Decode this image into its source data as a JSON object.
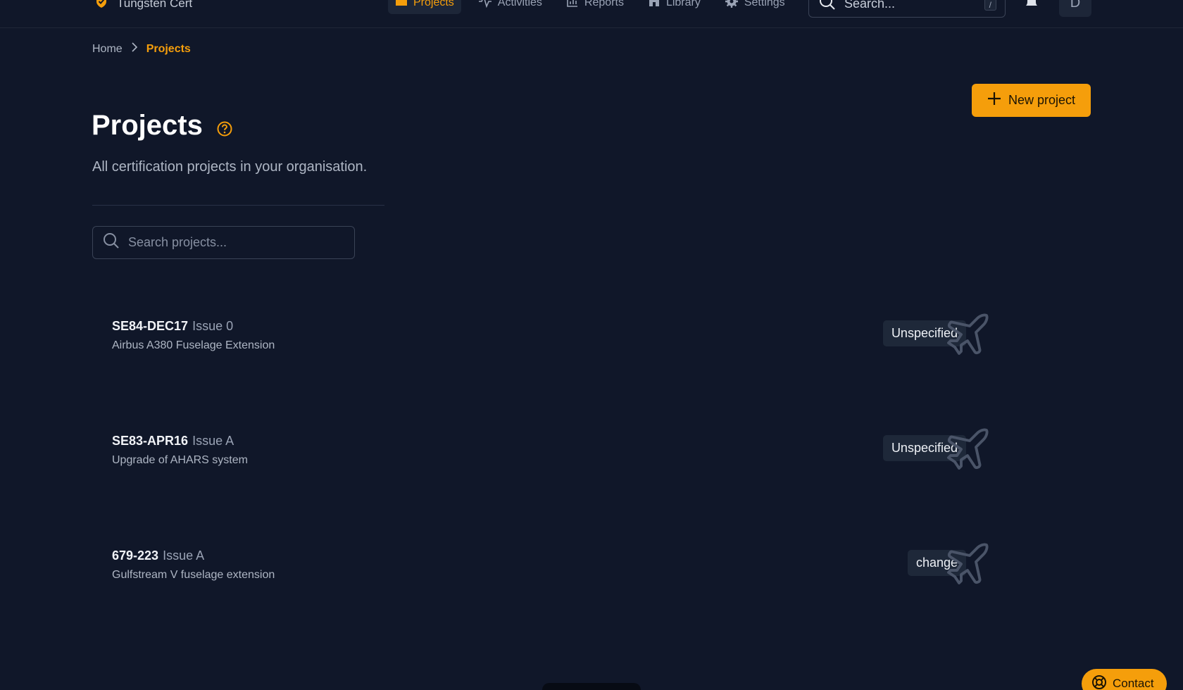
{
  "app": {
    "name": "Tungsten Cert",
    "accent": "#f59e0b",
    "background": "#101729"
  },
  "nav": [
    {
      "label": "Projects",
      "icon": "folder-icon",
      "active": true
    },
    {
      "label": "Activities",
      "icon": "activity-icon",
      "active": false
    },
    {
      "label": "Reports",
      "icon": "bar-chart-icon",
      "active": false
    },
    {
      "label": "Library",
      "icon": "library-icon",
      "active": false
    },
    {
      "label": "Settings",
      "icon": "gear-icon",
      "active": false
    }
  ],
  "top_search": {
    "placeholder": "Search...",
    "shortcut": "/"
  },
  "user": {
    "initial": "D"
  },
  "breadcrumb": {
    "home": "Home",
    "current": "Projects"
  },
  "page": {
    "title": "Projects",
    "subtitle": "All certification projects in your organisation.",
    "new_button": "New project",
    "search_placeholder": "Search projects..."
  },
  "projects": [
    {
      "id": "SE84-DEC17",
      "issue": "Issue 0",
      "description": "Airbus A380 Fuselage Extension",
      "badge": "Unspecified",
      "icon": "airplane-icon"
    },
    {
      "id": "SE83-APR16",
      "issue": "Issue A",
      "description": "Upgrade of AHARS system",
      "badge": "Unspecified",
      "icon": "airplane-icon"
    },
    {
      "id": "679-223",
      "issue": "Issue A",
      "description": "Gulfstream V fuselage extension",
      "badge": "change",
      "icon": "airplane-icon"
    }
  ],
  "contact": {
    "label": "Contact"
  }
}
